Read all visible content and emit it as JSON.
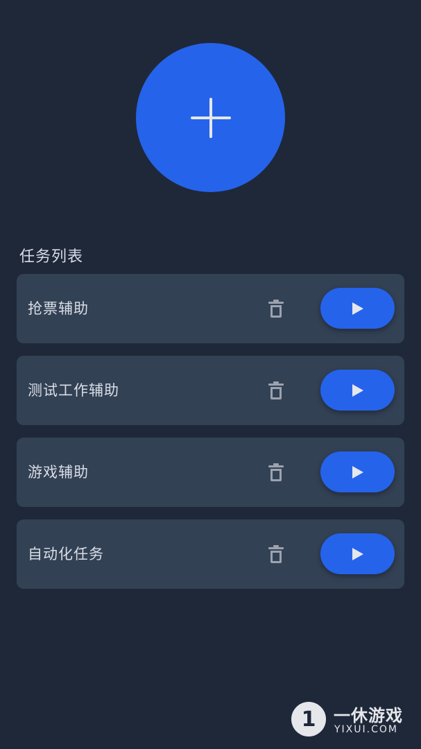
{
  "header": {
    "add_button_icon": "plus-icon"
  },
  "section": {
    "title": "任务列表"
  },
  "tasks": [
    {
      "name": "抢票辅助"
    },
    {
      "name": "测试工作辅助"
    },
    {
      "name": "游戏辅助"
    },
    {
      "name": "自动化任务"
    }
  ],
  "icons": {
    "delete": "trash-icon",
    "run": "play-icon"
  },
  "colors": {
    "background": "#1f2839",
    "card": "#334155",
    "accent": "#2563eb"
  },
  "watermark": {
    "logo_char": "1",
    "title": "一休游戏",
    "url": "YIXUI.COM"
  }
}
